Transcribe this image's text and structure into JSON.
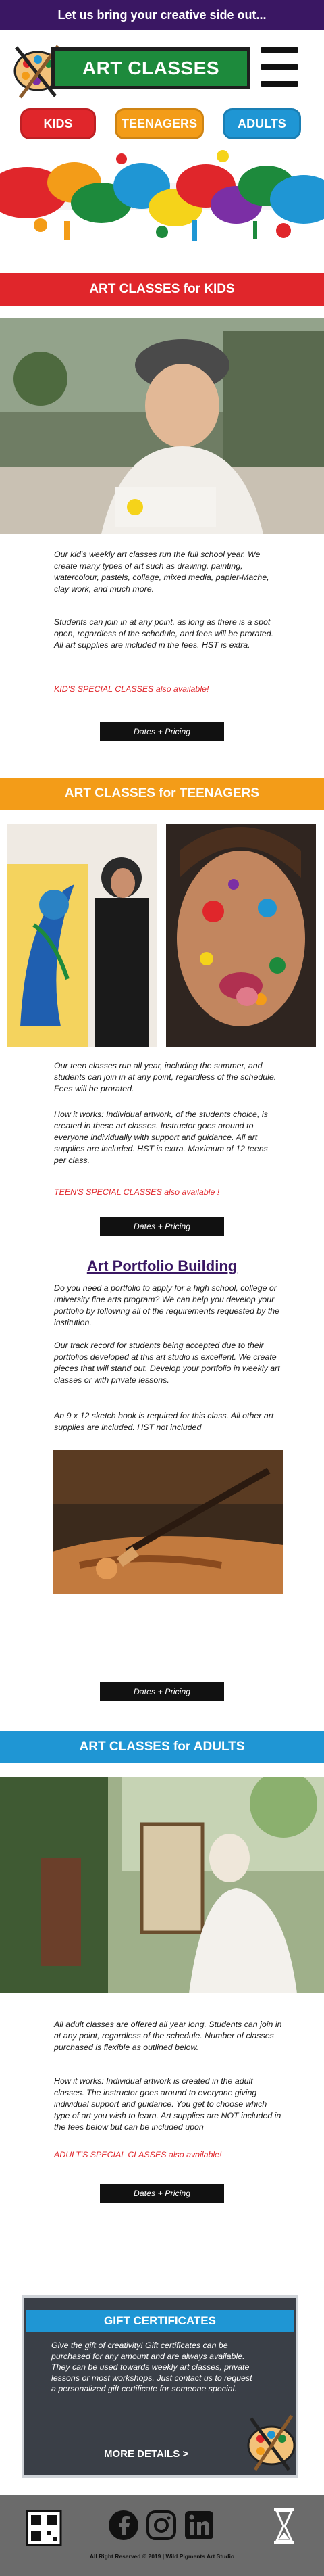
{
  "header": {
    "tagline": "Let us bring your creative side out...",
    "logo_text": "ART CLASSES"
  },
  "nav": {
    "kids": "KIDS",
    "teenagers": "TEENAGERS",
    "adults": "ADULTS"
  },
  "kids": {
    "title": "ART CLASSES for KIDS",
    "p1": "Our kid's weekly art classes run the full school year. We create many types of art such as drawing, painting, watercolour, pastels, collage, mixed media, papier-Mache, clay work, and much more.",
    "p2": "Students can join in at any point, as long as there is a spot open, regardless of the schedule, and fees will be prorated.  All art supplies are included in the fees.  HST is extra.",
    "special": "KID'S SPECIAL CLASSES  also available!",
    "button": "Dates + Pricing"
  },
  "teens": {
    "title": "ART CLASSES for TEENAGERS",
    "p1": "Our teen classes run all year, including the summer, and students can join in at any point, regardless of the schedule.  Fees will be prorated.",
    "p2": "How it works: Individual artwork, of the students choice, is created in these art classes.  Instructor goes around to everyone individually with support and guidance.  All art supplies are included. HST is extra. Maximum of 12 teens per class.",
    "special": "TEEN'S SPECIAL CLASSES  also available !",
    "button": "Dates + Pricing"
  },
  "portfolio": {
    "title": "Art Portfolio Building",
    "p1": "Do you need a portfolio to apply for a high school, college or university fine arts program? We can help you develop your portfolio by following all of the requirements requested by the institution.",
    "p2": "Our track record for students being accepted due to their portfolios developed at this art studio is excellent. We create pieces that will stand out. Develop your portfolio in weekly art classes or with private lessons.",
    "p3": "An 9 x 12 sketch book is required for this class.  All other art supplies are included.  HST not included",
    "button": "Dates + Pricing"
  },
  "adults": {
    "title": "ART CLASSES for ADULTS",
    "p1": "All adult classes are offered all year long. Students can join in at any point, regardless of the schedule.  Number of classes purchased is flexible as outlined below.",
    "p2": "How it works: Individual artwork is created in the adult classes.  The instructor goes around to everyone giving individual support and guidance.  You get to choose which type of art you wish to learn. Art supplies are NOT included in the fees below but can be included upon",
    "special": "ADULT'S SPECIAL CLASSES  also available!",
    "button": "Dates + Pricing"
  },
  "gift": {
    "title": "GIFT CERTIFICATES",
    "text": "Give the gift of creativity!  Gift certificates can be purchased for any amount and are always available. They can be used towards weekly art classes, private lessons or most workshops.  Just contact us to request a personalized gift certificate for someone special.",
    "more": "MORE DETAILS >"
  },
  "footer": {
    "copyright": "All Right Reserved © 2019 | Wild Pigments Art Studio",
    "icons": [
      "qr-code-icon",
      "facebook-icon",
      "instagram-icon",
      "linkedin-icon",
      "hourglass-icon"
    ]
  },
  "colors": {
    "purple": "#3a1763",
    "red": "#e0262b",
    "orange": "#f39c18",
    "blue": "#1f96d4",
    "green": "#1d8a3c"
  }
}
